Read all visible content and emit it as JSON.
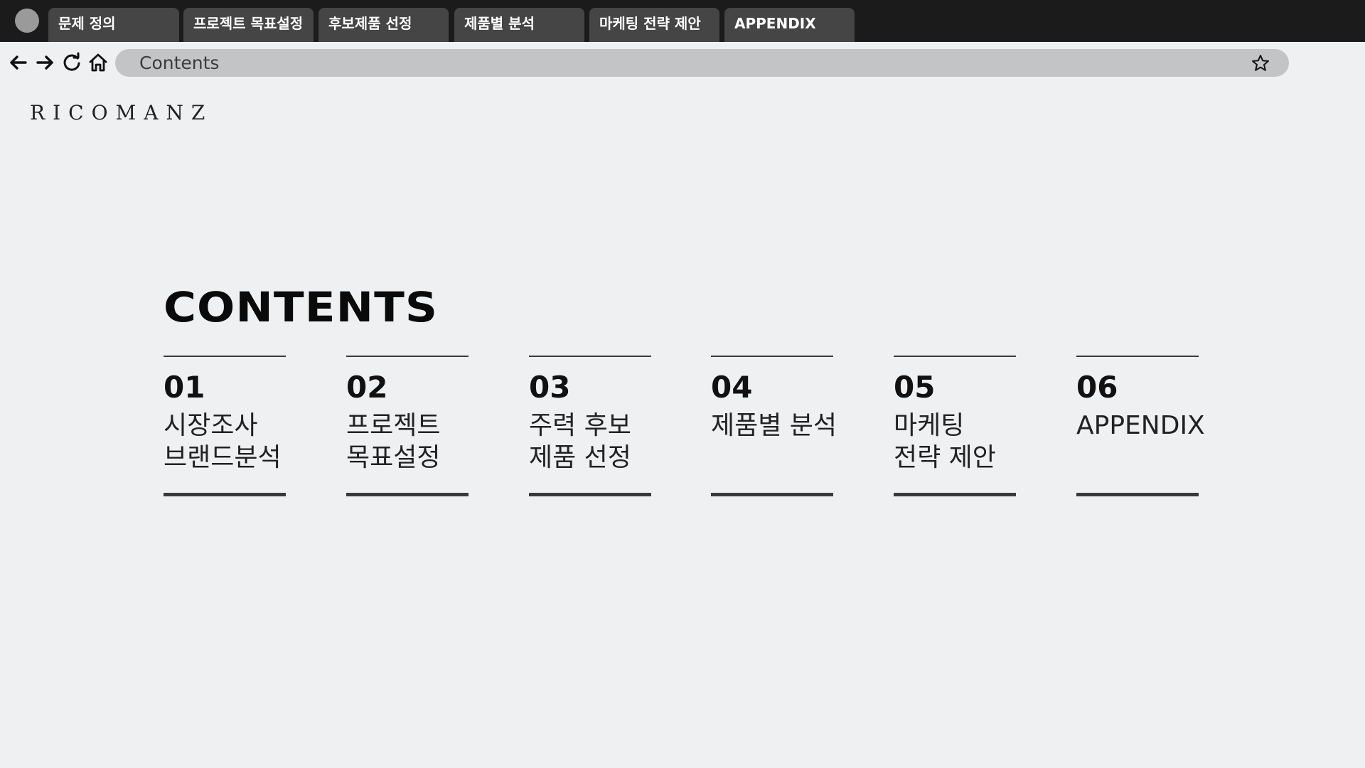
{
  "browser": {
    "tabs": [
      {
        "label": "문제 정의"
      },
      {
        "label": "프로젝트 목표설정"
      },
      {
        "label": "후보제품 선정"
      },
      {
        "label": "제품별 분석"
      },
      {
        "label": "마케팅 전략 제안"
      },
      {
        "label": "APPENDIX"
      }
    ],
    "address": "Contents",
    "icons": [
      "back-arrow-icon",
      "forward-arrow-icon",
      "refresh-icon",
      "home-icon",
      "star-icon"
    ]
  },
  "logo": {
    "text": "RICOMANZ"
  },
  "page": {
    "title": "CONTENTS",
    "items": [
      {
        "number": "01",
        "label": "시장조사\n브랜드분석"
      },
      {
        "number": "02",
        "label": "프로젝트\n목표설정"
      },
      {
        "number": "03",
        "label": "주력 후보\n제품 선정"
      },
      {
        "number": "04",
        "label": "제품별 분석"
      },
      {
        "number": "05",
        "label": "마케팅\n전략 제안"
      },
      {
        "number": "06",
        "label": "APPENDIX"
      }
    ]
  },
  "colors": {
    "tabbar_bg": "#1b1b1b",
    "tab_bg": "#454545",
    "page_bg": "#eff0f2",
    "addressbar_bg": "#c3c4c6",
    "rule": "#3a3a3a"
  }
}
